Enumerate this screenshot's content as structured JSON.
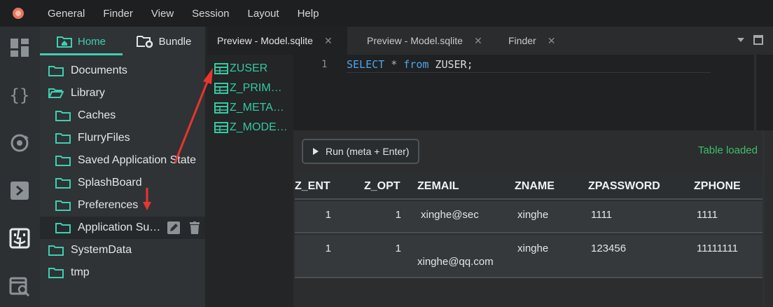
{
  "menubar": {
    "items": [
      "General",
      "Finder",
      "View",
      "Session",
      "Layout",
      "Help"
    ]
  },
  "activity": {
    "icons": [
      "dashboard-icon",
      "code-braces-icon",
      "sync-gear-icon",
      "terminal-icon",
      "finder-icon",
      "calendar-search-icon"
    ]
  },
  "sidebar": {
    "tabs": [
      {
        "label": "Home",
        "icon": "home-folder-icon"
      },
      {
        "label": "Bundle",
        "icon": "gear-folder-icon"
      }
    ],
    "tree": [
      {
        "label": "Documents",
        "level": 0,
        "open": false
      },
      {
        "label": "Library",
        "level": 0,
        "open": true
      },
      {
        "label": "Caches",
        "level": 1,
        "open": false
      },
      {
        "label": "FlurryFiles",
        "level": 1,
        "open": false
      },
      {
        "label": "Saved Application State",
        "level": 1,
        "open": false
      },
      {
        "label": "SplashBoard",
        "level": 1,
        "open": false
      },
      {
        "label": "Preferences",
        "level": 1,
        "open": false
      },
      {
        "label": "Application Su…",
        "level": 1,
        "open": false,
        "selected": true
      },
      {
        "label": "SystemData",
        "level": 0,
        "open": false
      },
      {
        "label": "tmp",
        "level": 0,
        "open": false
      }
    ]
  },
  "tabs": [
    {
      "label": "Preview - Model.sqlite",
      "active": true
    },
    {
      "label": "Preview - Model.sqlite",
      "active": false
    },
    {
      "label": "Finder",
      "active": false
    }
  ],
  "tables": [
    "ZUSER",
    "Z_PRIM…",
    "Z_META…",
    "Z_MODE…"
  ],
  "editor": {
    "line_number": "1",
    "code": [
      {
        "t": "SELECT",
        "k": "kw"
      },
      {
        "t": " ",
        "k": ""
      },
      {
        "t": "*",
        "k": "op"
      },
      {
        "t": " ",
        "k": ""
      },
      {
        "t": "from",
        "k": "kw"
      },
      {
        "t": " ZUSER;",
        "k": ""
      }
    ]
  },
  "results": {
    "run_label": "Run (meta + Enter)",
    "status": "Table loaded",
    "status_color": "#3fbf6a",
    "columns": [
      "Z_ENT",
      "Z_OPT",
      "ZEMAIL",
      "ZNAME",
      "ZPASSWORD",
      "ZPHONE"
    ],
    "rows": [
      [
        "1",
        "1",
        "xinghe@sec",
        "xinghe",
        "1111",
        "1111"
      ],
      [
        "1",
        "1",
        "xinghe@qq.com",
        "xinghe",
        "123456",
        "11111111"
      ]
    ]
  },
  "colors": {
    "accent": "#3ecfb0",
    "table_icon": "#36c9a2",
    "arrow": "#e8352d"
  }
}
